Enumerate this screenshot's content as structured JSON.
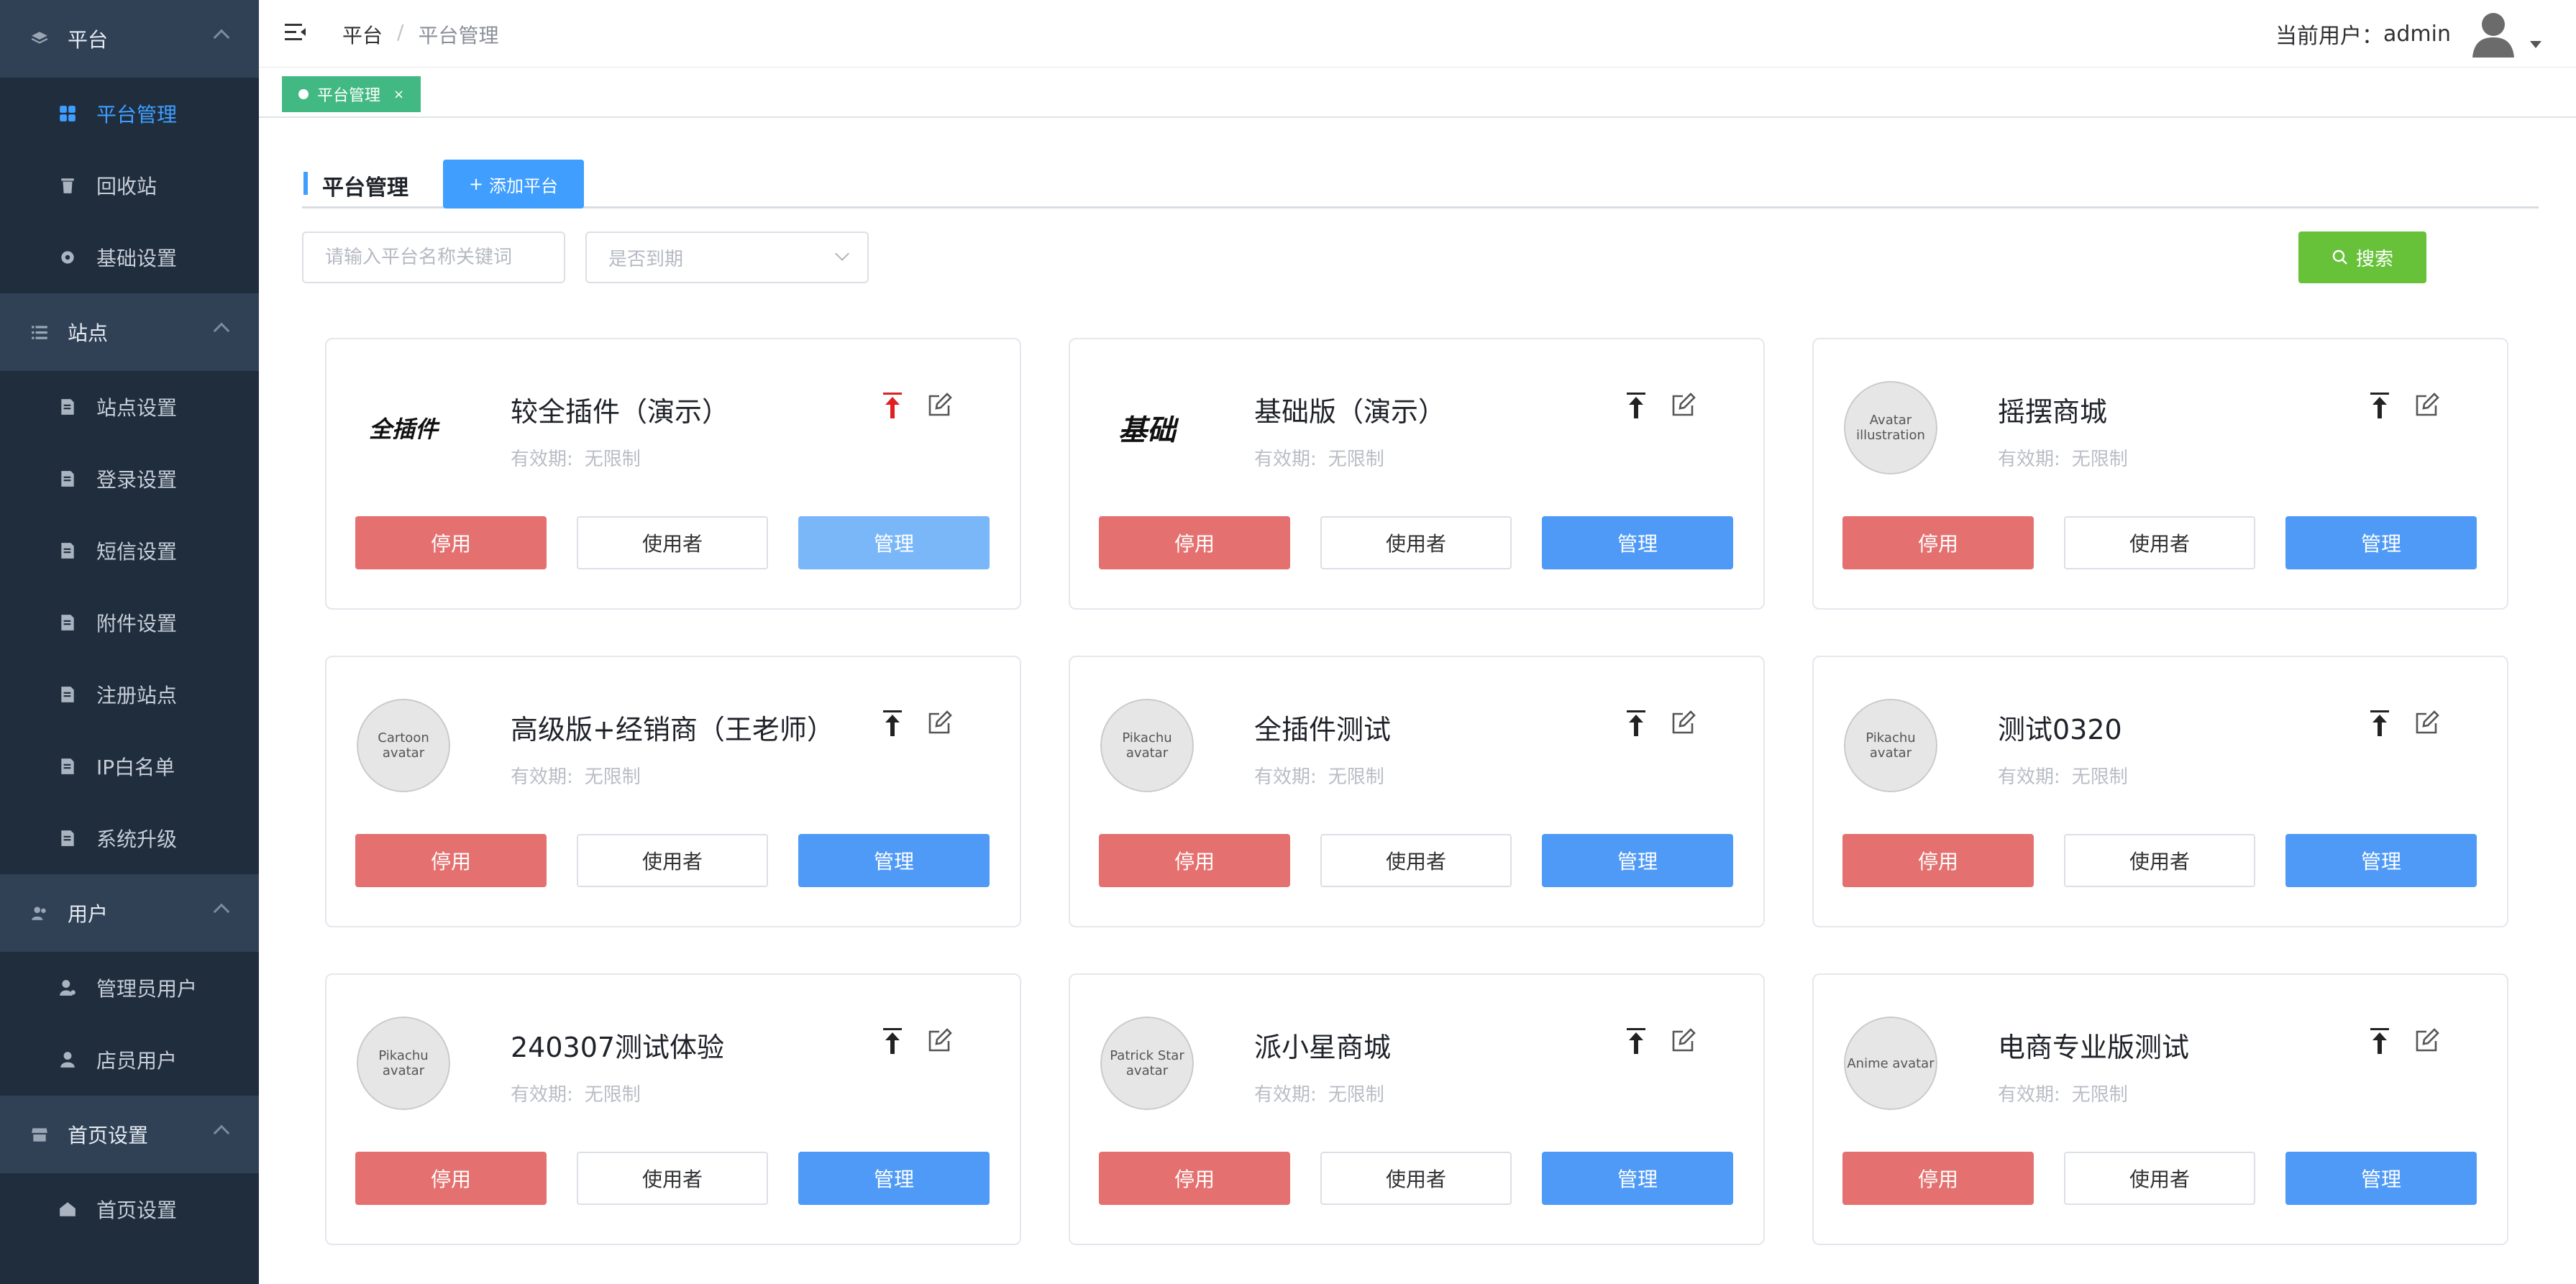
{
  "sidebar": {
    "groups": [
      {
        "label": "平台",
        "icon": "layers-icon",
        "items": [
          {
            "label": "平台管理",
            "icon": "grid-icon",
            "active": true
          },
          {
            "label": "回收站",
            "icon": "trash-icon"
          },
          {
            "label": "基础设置",
            "icon": "gear-icon"
          }
        ]
      },
      {
        "label": "站点",
        "icon": "list-icon",
        "items": [
          {
            "label": "站点设置",
            "icon": "site-settings-icon"
          },
          {
            "label": "登录设置",
            "icon": "login-settings-icon"
          },
          {
            "label": "短信设置",
            "icon": "sms-settings-icon"
          },
          {
            "label": "附件设置",
            "icon": "attachment-settings-icon"
          },
          {
            "label": "注册站点",
            "icon": "register-site-icon"
          },
          {
            "label": "IP白名单",
            "icon": "ip-whitelist-icon"
          },
          {
            "label": "系统升级",
            "icon": "upgrade-icon"
          }
        ]
      },
      {
        "label": "用户",
        "icon": "users-icon",
        "items": [
          {
            "label": "管理员用户",
            "icon": "admin-user-icon"
          },
          {
            "label": "店员用户",
            "icon": "clerk-user-icon"
          }
        ]
      },
      {
        "label": "首页设置",
        "icon": "store-icon",
        "items": [
          {
            "label": "首页设置",
            "icon": "home-icon"
          }
        ]
      }
    ]
  },
  "header": {
    "breadcrumb": [
      "平台",
      "平台管理"
    ],
    "breadcrumb_sep": "/",
    "user_label": "当前用户：",
    "user_name": "admin"
  },
  "tags": [
    {
      "label": "平台管理",
      "close": "×"
    }
  ],
  "main": {
    "title": "平台管理",
    "add_button": "添加平台",
    "search_placeholder": "请输入平台名称关键词",
    "expire_select": "是否到期",
    "search_button": "搜索"
  },
  "card_labels": {
    "validity_label": "有效期:",
    "stop": "停用",
    "users": "使用者",
    "manage": "管理"
  },
  "cards": [
    {
      "name": "较全插件（演示）",
      "validity": "无限制",
      "logo_type": "wordmark",
      "logo_text": "全插件",
      "top_active": true,
      "manage_light": true
    },
    {
      "name": "基础版（演示）",
      "validity": "无限制",
      "logo_type": "wordmark",
      "logo_text": "基础"
    },
    {
      "name": "摇摆商城",
      "validity": "无限制",
      "logo_type": "image",
      "logo_alt": "Avatar illustration"
    },
    {
      "name": "高级版+经销商（王老师）",
      "validity": "无限制",
      "logo_type": "image",
      "logo_alt": "Cartoon avatar"
    },
    {
      "name": "全插件测试",
      "validity": "无限制",
      "logo_type": "image",
      "logo_alt": "Pikachu avatar"
    },
    {
      "name": "测试0320",
      "validity": "无限制",
      "logo_type": "image",
      "logo_alt": "Pikachu avatar"
    },
    {
      "name": "240307测试体验",
      "validity": "无限制",
      "logo_type": "image",
      "logo_alt": "Pikachu avatar"
    },
    {
      "name": "派小星商城",
      "validity": "无限制",
      "logo_type": "image",
      "logo_alt": "Patrick Star avatar"
    },
    {
      "name": "电商专业版测试",
      "validity": "无限制",
      "logo_type": "image",
      "logo_alt": "Anime avatar"
    }
  ],
  "colors": {
    "sidebar_bg": "#1f2d3d",
    "sidebar_group_bg": "#304156",
    "accent": "#409eff",
    "tag_green": "#42b983",
    "search_green": "#67c23a",
    "stop_red": "#e4716f",
    "manage_blue": "#4f9af6",
    "top_active_red": "#e02020"
  }
}
